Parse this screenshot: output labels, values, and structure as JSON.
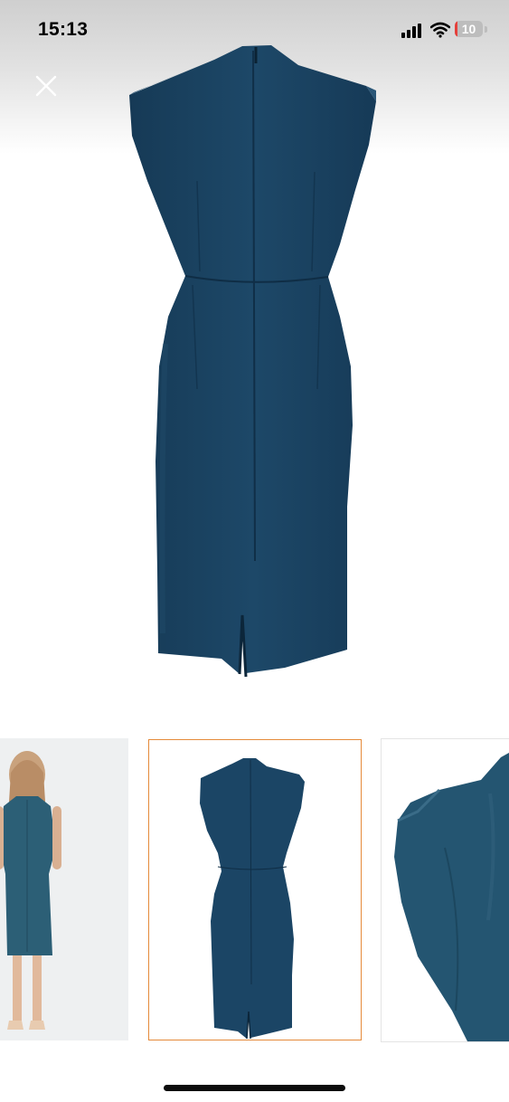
{
  "status_bar": {
    "time": "15:13",
    "battery_level": "10",
    "battery_fraction": 0.1,
    "signal_icon": "cellular-signal-icon",
    "wifi_icon": "wifi-icon"
  },
  "viewer": {
    "close_icon": "close-icon",
    "main_image": "navy-sleeveless-sheath-dress-back-view",
    "thumbnails": [
      {
        "image": "model-wearing-dress-back-view",
        "selected": false
      },
      {
        "image": "dress-back-view",
        "selected": true
      },
      {
        "image": "dress-shoulder-detail",
        "selected": false
      }
    ]
  },
  "colors": {
    "dress": "#1b4565",
    "selected_thumb_border": "#e58a3a",
    "battery_low": "#e5403b"
  }
}
